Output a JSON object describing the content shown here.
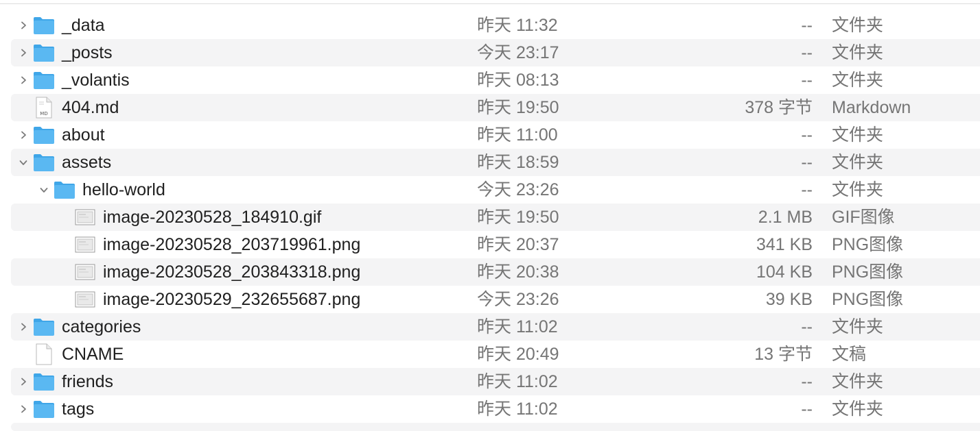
{
  "rows": [
    {
      "name": "_data",
      "date": "昨天 11:32",
      "size": "--",
      "kind": "文件夹",
      "icon": "folder-icon",
      "chevron": "right",
      "level": 0
    },
    {
      "name": "_posts",
      "date": "今天 23:17",
      "size": "--",
      "kind": "文件夹",
      "icon": "folder-icon",
      "chevron": "right",
      "level": 0
    },
    {
      "name": "_volantis",
      "date": "昨天 08:13",
      "size": "--",
      "kind": "文件夹",
      "icon": "folder-icon",
      "chevron": "right",
      "level": 0
    },
    {
      "name": "404.md",
      "date": "昨天 19:50",
      "size": "378 字节",
      "kind": "Markdown",
      "icon": "markdown-file-icon",
      "chevron": "none",
      "level": 0
    },
    {
      "name": "about",
      "date": "昨天 11:00",
      "size": "--",
      "kind": "文件夹",
      "icon": "folder-icon",
      "chevron": "right",
      "level": 0
    },
    {
      "name": "assets",
      "date": "昨天 18:59",
      "size": "--",
      "kind": "文件夹",
      "icon": "folder-icon",
      "chevron": "down",
      "level": 0
    },
    {
      "name": "hello-world",
      "date": "今天 23:26",
      "size": "--",
      "kind": "文件夹",
      "icon": "folder-icon",
      "chevron": "down",
      "level": 1
    },
    {
      "name": "image-20230528_184910.gif",
      "date": "昨天 19:50",
      "size": "2.1 MB",
      "kind": "GIF图像",
      "icon": "image-file-icon",
      "chevron": "none",
      "level": 2
    },
    {
      "name": "image-20230528_203719961.png",
      "date": "昨天 20:37",
      "size": "341 KB",
      "kind": "PNG图像",
      "icon": "image-file-icon",
      "chevron": "none",
      "level": 2
    },
    {
      "name": "image-20230528_203843318.png",
      "date": "昨天 20:38",
      "size": "104 KB",
      "kind": "PNG图像",
      "icon": "image-file-icon",
      "chevron": "none",
      "level": 2
    },
    {
      "name": "image-20230529_232655687.png",
      "date": "今天 23:26",
      "size": "39 KB",
      "kind": "PNG图像",
      "icon": "image-file-icon",
      "chevron": "none",
      "level": 2
    },
    {
      "name": "categories",
      "date": "昨天 11:02",
      "size": "--",
      "kind": "文件夹",
      "icon": "folder-icon",
      "chevron": "right",
      "level": 0
    },
    {
      "name": "CNAME",
      "date": "昨天 20:49",
      "size": "13 字节",
      "kind": "文稿",
      "icon": "document-icon",
      "chevron": "none",
      "level": 0
    },
    {
      "name": "friends",
      "date": "昨天 11:02",
      "size": "--",
      "kind": "文件夹",
      "icon": "folder-icon",
      "chevron": "right",
      "level": 0
    },
    {
      "name": "tags",
      "date": "昨天 11:02",
      "size": "--",
      "kind": "文件夹",
      "icon": "folder-icon",
      "chevron": "right",
      "level": 0
    }
  ],
  "colors": {
    "folder": "#5ab8f2",
    "folder_dark": "#3fa6e8",
    "stripe": "#f4f4f5",
    "secondary_text": "#757575"
  }
}
